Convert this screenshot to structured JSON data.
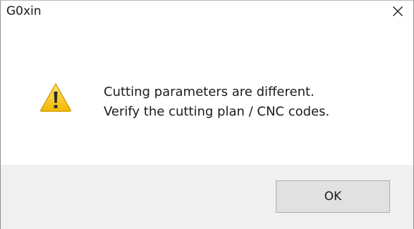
{
  "window": {
    "title": "G0xin",
    "close_icon": "close-icon"
  },
  "dialog": {
    "icon": "warning-icon",
    "message_line1": "Cutting parameters are different.",
    "message_line2": "Verify the cutting plan / CNC codes."
  },
  "buttons": {
    "ok_label": "OK"
  },
  "colors": {
    "footer_bg": "#f0f0f0",
    "button_bg": "#e1e1e1",
    "button_border": "#adadad",
    "warning_yellow": "#f5c400"
  }
}
